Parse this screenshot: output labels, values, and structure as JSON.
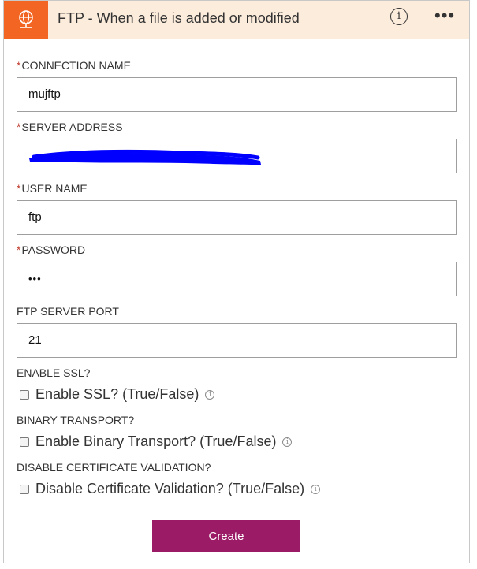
{
  "header": {
    "title": "FTP - When a file is added or modified",
    "info_glyph": "i",
    "more_glyph": "•••",
    "brand_color": "#f26522",
    "header_bg": "#fcecdc"
  },
  "form": {
    "connection_name": {
      "required": "*",
      "label": "CONNECTION NAME",
      "value": "mujftp"
    },
    "server_address": {
      "required": "*",
      "label": "SERVER ADDRESS",
      "value": ""
    },
    "user_name": {
      "required": "*",
      "label": "USER NAME",
      "value": "ftp"
    },
    "password": {
      "required": "*",
      "label": "PASSWORD",
      "value": "•••"
    },
    "port": {
      "label": "FTP SERVER PORT",
      "value": "21"
    },
    "enable_ssl": {
      "label": "ENABLE SSL?",
      "checkbox_label": "Enable SSL? (True/False)",
      "checked": false
    },
    "binary_transport": {
      "label": "BINARY TRANSPORT?",
      "checkbox_label": "Enable Binary Transport? (True/False)",
      "checked": false
    },
    "disable_cert": {
      "label": "DISABLE CERTIFICATE VALIDATION?",
      "checkbox_label": "Disable Certificate Validation? (True/False)",
      "checked": false
    }
  },
  "actions": {
    "create_label": "Create",
    "create_color": "#9b1b66"
  },
  "redaction_color": "#0000ff"
}
